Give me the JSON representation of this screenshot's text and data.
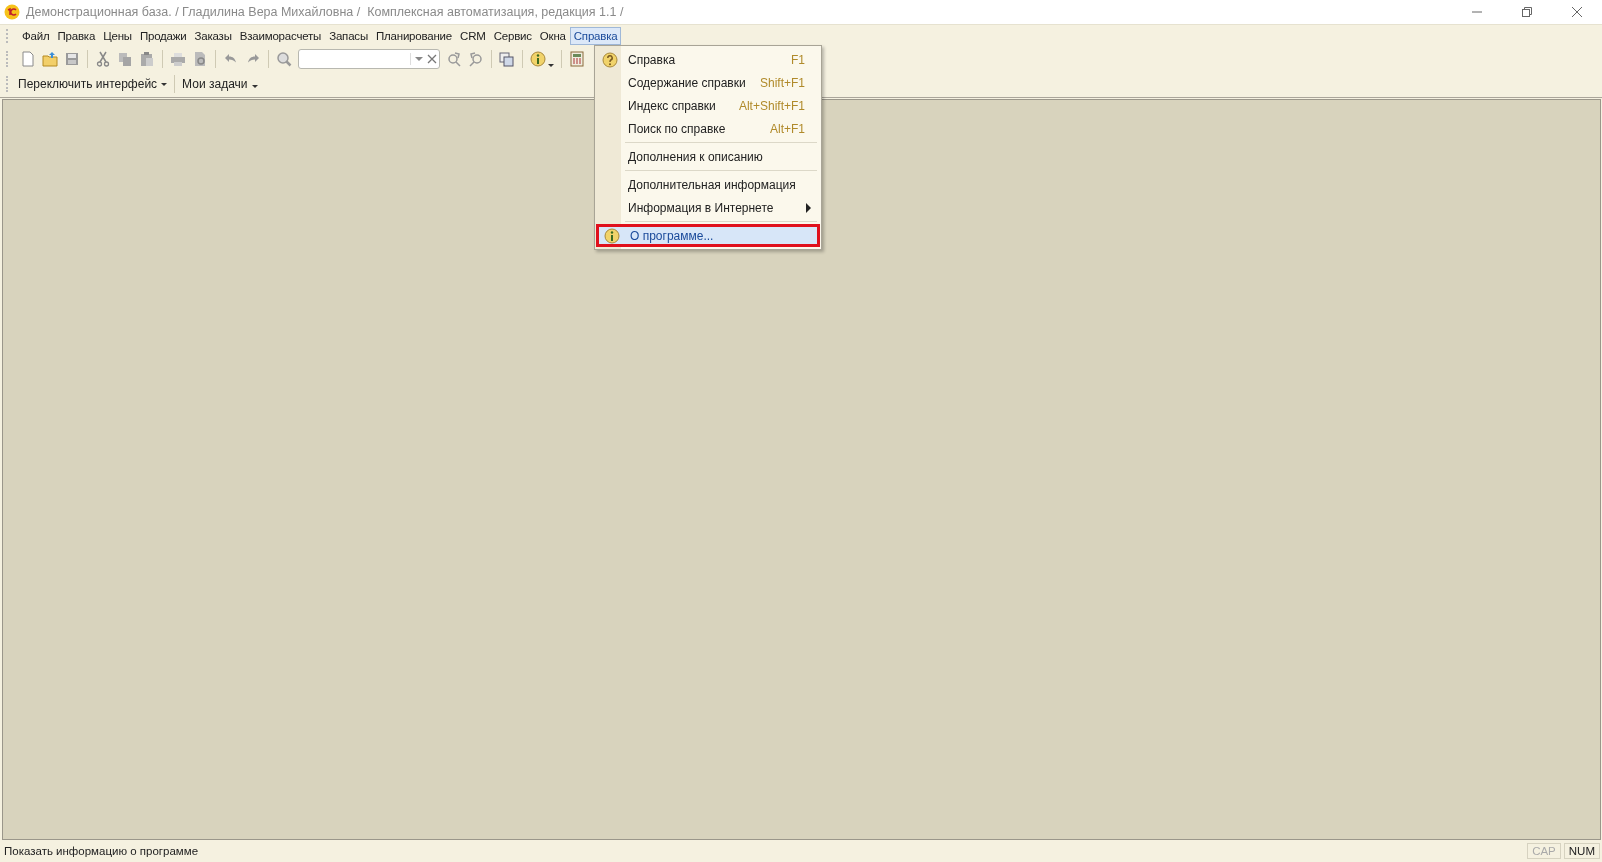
{
  "window": {
    "title": "Демонстрационная база. / Гладилина Вера Михайловна /  Комплексная автоматизация, редакция 1.1 /"
  },
  "menu_bar": [
    {
      "label": "Файл",
      "selected": false
    },
    {
      "label": "Правка",
      "selected": false
    },
    {
      "label": "Цены",
      "selected": false
    },
    {
      "label": "Продажи",
      "selected": false
    },
    {
      "label": "Заказы",
      "selected": false
    },
    {
      "label": "Взаиморасчеты",
      "selected": false
    },
    {
      "label": "Запасы",
      "selected": false
    },
    {
      "label": "Планирование",
      "selected": false
    },
    {
      "label": "CRM",
      "selected": false
    },
    {
      "label": "Сервис",
      "selected": false
    },
    {
      "label": "Окна",
      "selected": false
    },
    {
      "label": "Справка",
      "selected": true
    }
  ],
  "toolbar2": [
    {
      "label": "Переключить интерфейс",
      "kind": "dropdown"
    },
    {
      "label": "Мои задачи",
      "kind": "menu"
    }
  ],
  "help_menu": [
    {
      "kind": "item",
      "label": "Справка",
      "shortcut": "F1",
      "selected": false
    },
    {
      "kind": "item",
      "label": "Содержание справки",
      "shortcut": "Shift+F1",
      "selected": false
    },
    {
      "kind": "item",
      "label": "Индекс справки",
      "shortcut": "Alt+Shift+F1",
      "selected": false
    },
    {
      "kind": "item",
      "label": "Поиск по справке",
      "shortcut": "Alt+F1",
      "selected": false
    },
    {
      "kind": "separator"
    },
    {
      "kind": "item",
      "label": "Дополнения к описанию",
      "selected": false
    },
    {
      "kind": "separator"
    },
    {
      "kind": "item",
      "label": "Дополнительная информация",
      "selected": false
    },
    {
      "kind": "submenu",
      "label": "Информация в Интернете",
      "selected": false
    },
    {
      "kind": "separator"
    },
    {
      "kind": "item",
      "label": "О программе...",
      "selected": true
    }
  ],
  "status_bar": {
    "message": "Показать информацию о программе",
    "indicators": [
      {
        "label": "CAP",
        "on": false
      },
      {
        "label": "NUM",
        "on": true
      }
    ]
  }
}
